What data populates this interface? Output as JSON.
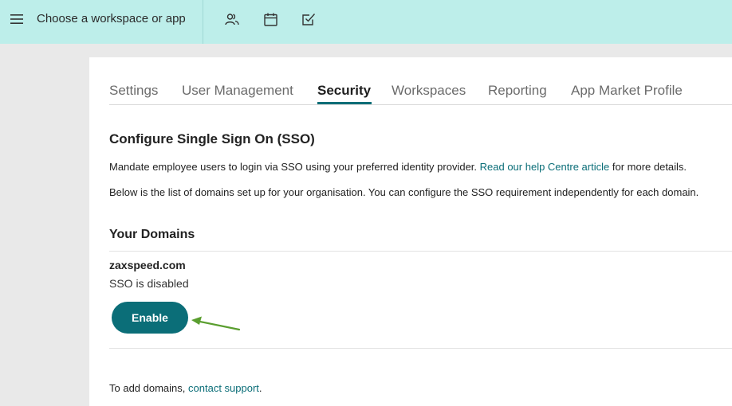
{
  "topbar": {
    "workspace_label": "Choose a workspace or app",
    "icons": [
      "menu-icon",
      "people-icon",
      "calendar-icon",
      "checkbox-icon"
    ],
    "background": "#bdeeea"
  },
  "tabs": [
    {
      "label": "Settings",
      "active": false
    },
    {
      "label": "User Management",
      "active": false
    },
    {
      "label": "Security",
      "active": true
    },
    {
      "label": "Workspaces",
      "active": false
    },
    {
      "label": "Reporting",
      "active": false
    },
    {
      "label": "App Market Profile",
      "active": false
    }
  ],
  "sso": {
    "title": "Configure Single Sign On (SSO)",
    "intro_before": "Mandate employee users to login via SSO using your preferred identity provider. ",
    "intro_link": "Read our help Centre article",
    "intro_after": " for more details.",
    "domains_note": "Below is the list of domains set up for your organisation. You can configure the SSO requirement independently for each domain."
  },
  "domains": {
    "heading": "Your Domains",
    "items": [
      {
        "name": "zaxspeed.com",
        "status": "SSO is disabled",
        "action_label": "Enable"
      }
    ]
  },
  "footer": {
    "before": "To add domains, ",
    "link": "contact support",
    "after": "."
  },
  "colors": {
    "accent": "#0b6e78",
    "arrow": "#5a9e2f"
  }
}
